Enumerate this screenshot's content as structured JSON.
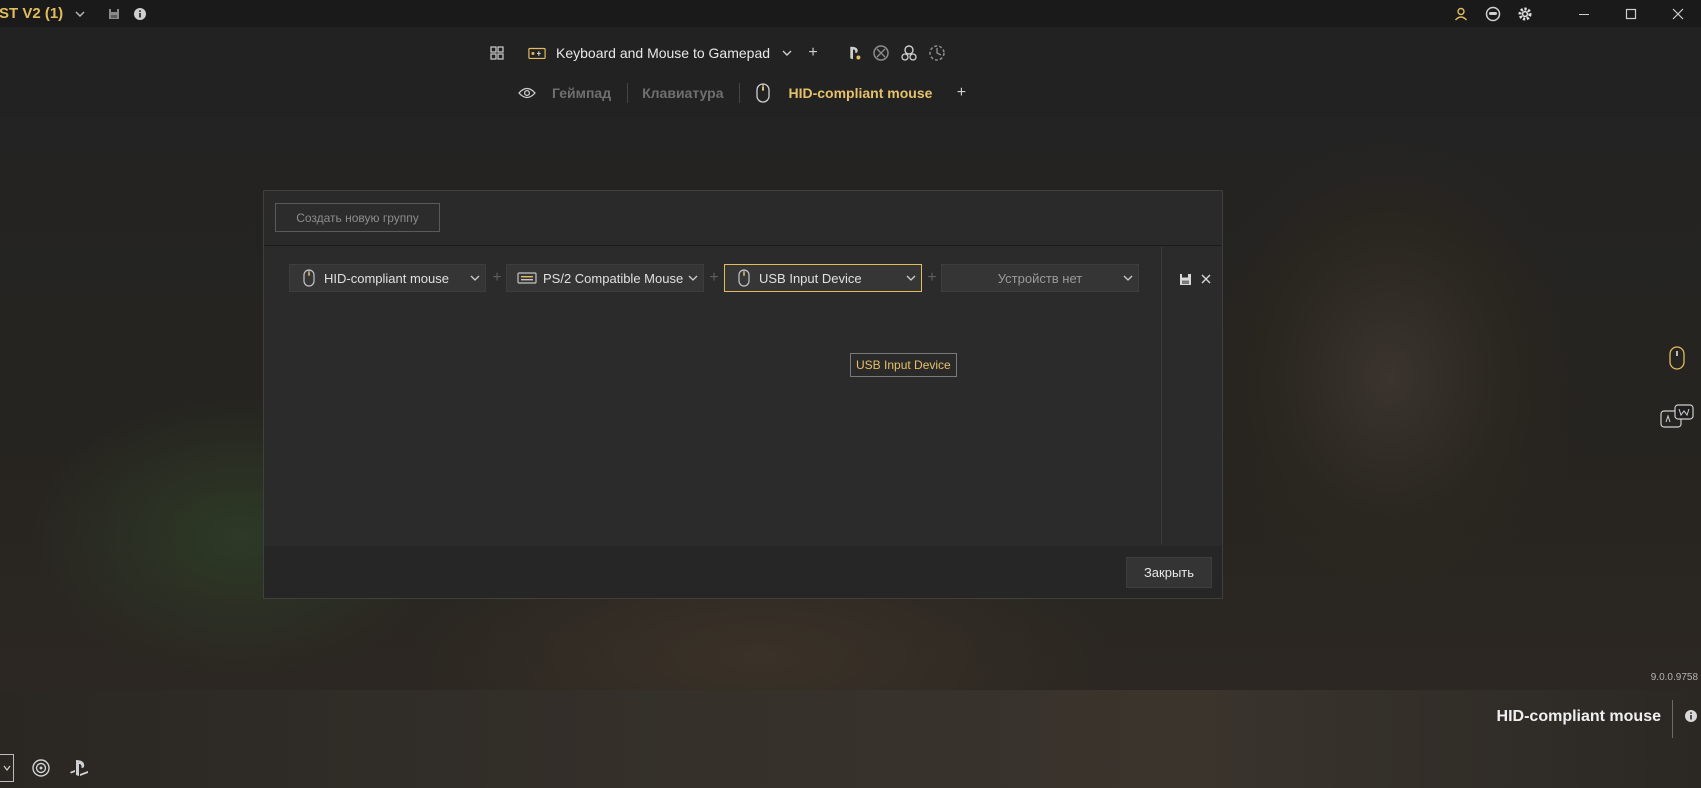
{
  "window": {
    "title": "ST V2 (1)",
    "icons": [
      "chevron-down-icon",
      "save-icon",
      "info-icon",
      "user-icon",
      "controller-icon",
      "gear-icon"
    ],
    "controls": [
      "minimize-icon",
      "maximize-icon",
      "close-icon"
    ]
  },
  "toolbar": {
    "profile_name": "Keyboard and Mouse to Gamepad",
    "add_label": "+",
    "tabs": [
      {
        "label": "Геймпад",
        "active": false
      },
      {
        "label": "Клавиатура",
        "active": false
      },
      {
        "label": "HID-compliant mouse",
        "active": true
      }
    ],
    "add_tab_label": "+"
  },
  "dialog": {
    "new_group_label": "Создать новую группу",
    "devices": [
      {
        "label": "HID-compliant mouse",
        "icon": "mouse-icon"
      },
      {
        "label": "PS/2 Compatible Mouse",
        "icon": "keyboard-icon"
      },
      {
        "label": "USB Input Device",
        "icon": "mouse-icon"
      },
      {
        "label": "Устройств нет",
        "icon": ""
      }
    ],
    "plus": "+",
    "tooltip": "USB Input Device",
    "close_label": "Закрыть"
  },
  "version": "9.0.0.9758",
  "status": {
    "device": "HID-compliant mouse"
  },
  "colors": {
    "accent": "#e2bc5e",
    "background": "#1b1b1b",
    "panel": "#2b2b2b"
  }
}
